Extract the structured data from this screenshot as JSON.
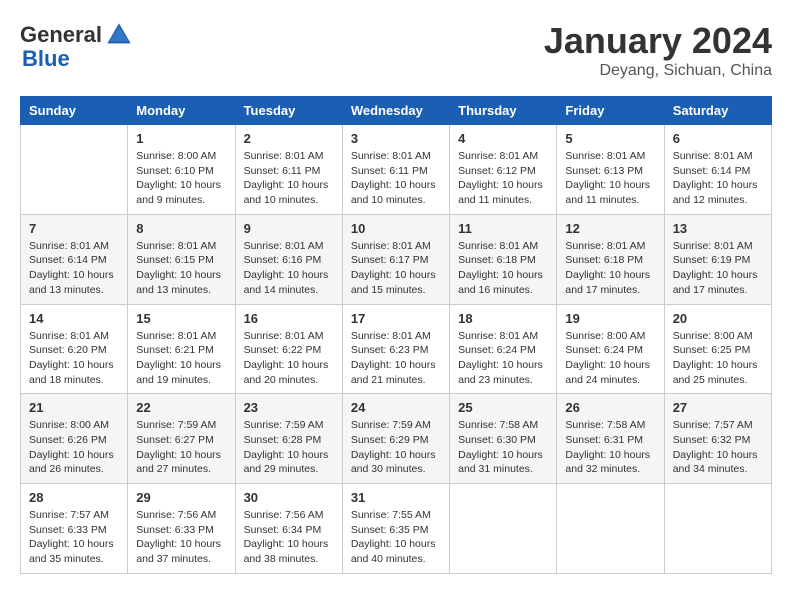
{
  "header": {
    "logo_general": "General",
    "logo_blue": "Blue",
    "month_title": "January 2024",
    "location": "Deyang, Sichuan, China"
  },
  "days_of_week": [
    "Sunday",
    "Monday",
    "Tuesday",
    "Wednesday",
    "Thursday",
    "Friday",
    "Saturday"
  ],
  "weeks": [
    [
      {
        "day": "",
        "info": ""
      },
      {
        "day": "1",
        "info": "Sunrise: 8:00 AM\nSunset: 6:10 PM\nDaylight: 10 hours\nand 9 minutes."
      },
      {
        "day": "2",
        "info": "Sunrise: 8:01 AM\nSunset: 6:11 PM\nDaylight: 10 hours\nand 10 minutes."
      },
      {
        "day": "3",
        "info": "Sunrise: 8:01 AM\nSunset: 6:11 PM\nDaylight: 10 hours\nand 10 minutes."
      },
      {
        "day": "4",
        "info": "Sunrise: 8:01 AM\nSunset: 6:12 PM\nDaylight: 10 hours\nand 11 minutes."
      },
      {
        "day": "5",
        "info": "Sunrise: 8:01 AM\nSunset: 6:13 PM\nDaylight: 10 hours\nand 11 minutes."
      },
      {
        "day": "6",
        "info": "Sunrise: 8:01 AM\nSunset: 6:14 PM\nDaylight: 10 hours\nand 12 minutes."
      }
    ],
    [
      {
        "day": "7",
        "info": "Sunrise: 8:01 AM\nSunset: 6:14 PM\nDaylight: 10 hours\nand 13 minutes."
      },
      {
        "day": "8",
        "info": "Sunrise: 8:01 AM\nSunset: 6:15 PM\nDaylight: 10 hours\nand 13 minutes."
      },
      {
        "day": "9",
        "info": "Sunrise: 8:01 AM\nSunset: 6:16 PM\nDaylight: 10 hours\nand 14 minutes."
      },
      {
        "day": "10",
        "info": "Sunrise: 8:01 AM\nSunset: 6:17 PM\nDaylight: 10 hours\nand 15 minutes."
      },
      {
        "day": "11",
        "info": "Sunrise: 8:01 AM\nSunset: 6:18 PM\nDaylight: 10 hours\nand 16 minutes."
      },
      {
        "day": "12",
        "info": "Sunrise: 8:01 AM\nSunset: 6:18 PM\nDaylight: 10 hours\nand 17 minutes."
      },
      {
        "day": "13",
        "info": "Sunrise: 8:01 AM\nSunset: 6:19 PM\nDaylight: 10 hours\nand 17 minutes."
      }
    ],
    [
      {
        "day": "14",
        "info": "Sunrise: 8:01 AM\nSunset: 6:20 PM\nDaylight: 10 hours\nand 18 minutes."
      },
      {
        "day": "15",
        "info": "Sunrise: 8:01 AM\nSunset: 6:21 PM\nDaylight: 10 hours\nand 19 minutes."
      },
      {
        "day": "16",
        "info": "Sunrise: 8:01 AM\nSunset: 6:22 PM\nDaylight: 10 hours\nand 20 minutes."
      },
      {
        "day": "17",
        "info": "Sunrise: 8:01 AM\nSunset: 6:23 PM\nDaylight: 10 hours\nand 21 minutes."
      },
      {
        "day": "18",
        "info": "Sunrise: 8:01 AM\nSunset: 6:24 PM\nDaylight: 10 hours\nand 23 minutes."
      },
      {
        "day": "19",
        "info": "Sunrise: 8:00 AM\nSunset: 6:24 PM\nDaylight: 10 hours\nand 24 minutes."
      },
      {
        "day": "20",
        "info": "Sunrise: 8:00 AM\nSunset: 6:25 PM\nDaylight: 10 hours\nand 25 minutes."
      }
    ],
    [
      {
        "day": "21",
        "info": "Sunrise: 8:00 AM\nSunset: 6:26 PM\nDaylight: 10 hours\nand 26 minutes."
      },
      {
        "day": "22",
        "info": "Sunrise: 7:59 AM\nSunset: 6:27 PM\nDaylight: 10 hours\nand 27 minutes."
      },
      {
        "day": "23",
        "info": "Sunrise: 7:59 AM\nSunset: 6:28 PM\nDaylight: 10 hours\nand 29 minutes."
      },
      {
        "day": "24",
        "info": "Sunrise: 7:59 AM\nSunset: 6:29 PM\nDaylight: 10 hours\nand 30 minutes."
      },
      {
        "day": "25",
        "info": "Sunrise: 7:58 AM\nSunset: 6:30 PM\nDaylight: 10 hours\nand 31 minutes."
      },
      {
        "day": "26",
        "info": "Sunrise: 7:58 AM\nSunset: 6:31 PM\nDaylight: 10 hours\nand 32 minutes."
      },
      {
        "day": "27",
        "info": "Sunrise: 7:57 AM\nSunset: 6:32 PM\nDaylight: 10 hours\nand 34 minutes."
      }
    ],
    [
      {
        "day": "28",
        "info": "Sunrise: 7:57 AM\nSunset: 6:33 PM\nDaylight: 10 hours\nand 35 minutes."
      },
      {
        "day": "29",
        "info": "Sunrise: 7:56 AM\nSunset: 6:33 PM\nDaylight: 10 hours\nand 37 minutes."
      },
      {
        "day": "30",
        "info": "Sunrise: 7:56 AM\nSunset: 6:34 PM\nDaylight: 10 hours\nand 38 minutes."
      },
      {
        "day": "31",
        "info": "Sunrise: 7:55 AM\nSunset: 6:35 PM\nDaylight: 10 hours\nand 40 minutes."
      },
      {
        "day": "",
        "info": ""
      },
      {
        "day": "",
        "info": ""
      },
      {
        "day": "",
        "info": ""
      }
    ]
  ]
}
